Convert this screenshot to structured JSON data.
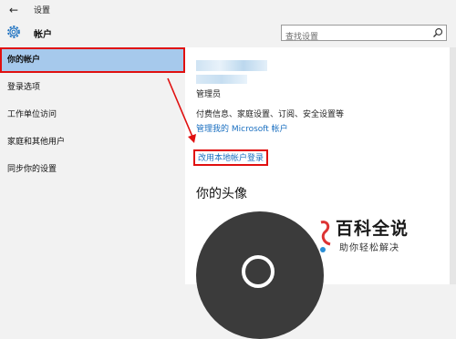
{
  "window": {
    "back_glyph": "←",
    "title": "设置"
  },
  "header": {
    "section_title": "帐户",
    "search": {
      "placeholder": "查找设置"
    }
  },
  "sidebar": {
    "items": [
      {
        "label": "你的帐户",
        "active": true
      },
      {
        "label": "登录选项",
        "active": false
      },
      {
        "label": "工作单位访问",
        "active": false
      },
      {
        "label": "家庭和其他用户",
        "active": false
      },
      {
        "label": "同步你的设置",
        "active": false
      }
    ]
  },
  "account": {
    "role": "管理员",
    "billing_info": "付费信息、家庭设置、订阅、安全设置等",
    "manage_link": "管理我的 Microsoft 帐户",
    "local_login_link": "改用本地帐户登录",
    "avatar_heading": "你的头像"
  },
  "watermark": {
    "main": "百科全说",
    "sub": "助你轻松解决"
  },
  "colors": {
    "accent": "#1a6fc0",
    "selected_bg": "#a6c9ec",
    "highlight_red": "#e01010",
    "avatar_bg": "#3b3b3b"
  },
  "icons": {
    "gear": "gear-icon",
    "search": "search-icon",
    "back": "back-arrow-icon"
  }
}
